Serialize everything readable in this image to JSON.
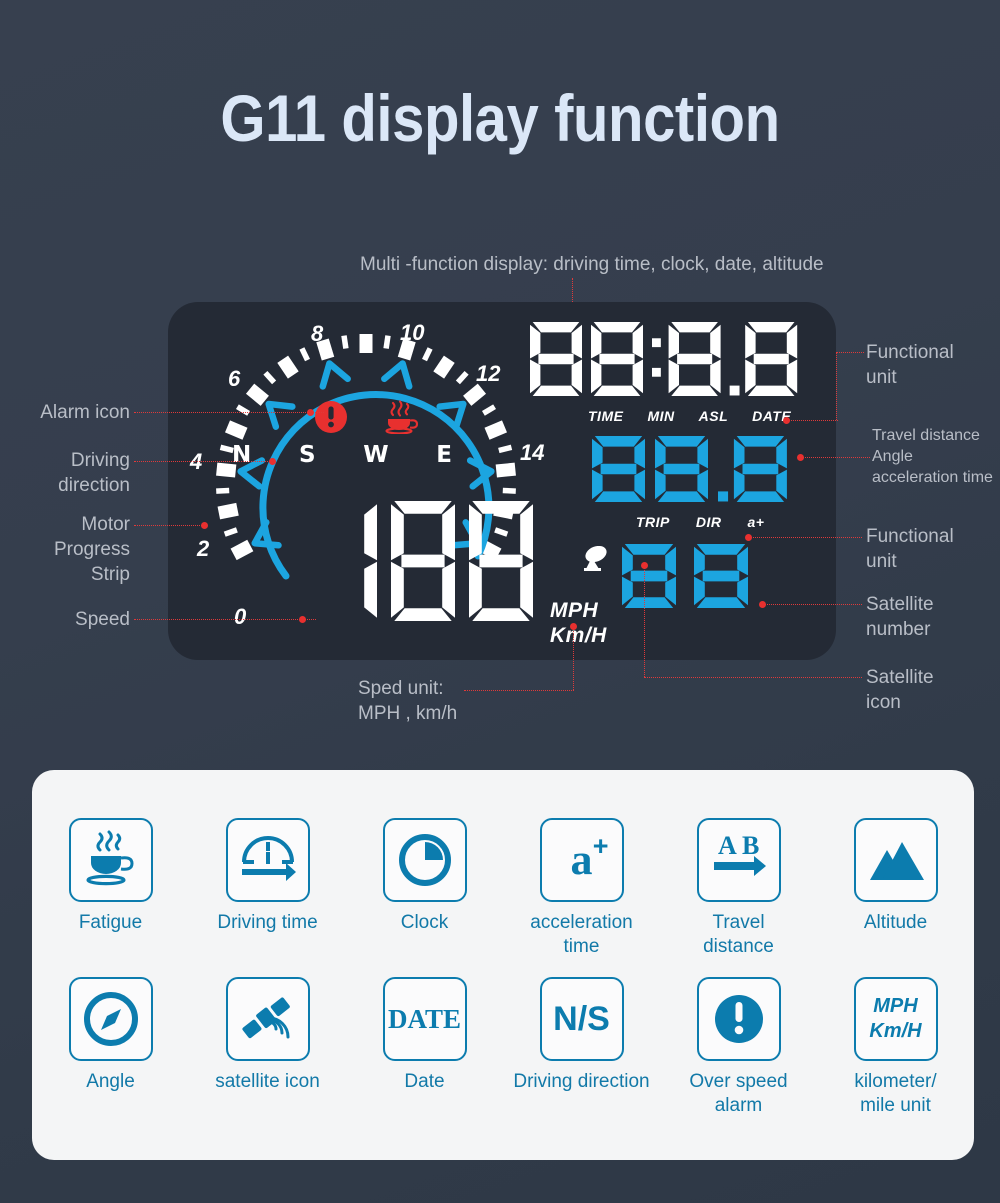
{
  "header": {
    "title": "G11 display function"
  },
  "hud": {
    "gauge": {
      "tick_labels": [
        "0",
        "2",
        "4",
        "6",
        "8",
        "10",
        "12",
        "14"
      ],
      "compass_letters": [
        "N",
        "S",
        "W",
        "E"
      ],
      "speed_value": "188",
      "speed_units": {
        "mph": "MPH",
        "kmh": "Km/H"
      },
      "alarm_icon": "alert-exclamation-icon",
      "fatigue_icon": "coffee-cup-icon"
    },
    "multi_display": {
      "value": "88:8.8",
      "labels": [
        "TIME",
        "MIN",
        "ASL",
        "DATE"
      ]
    },
    "trip_display": {
      "value": "88.8",
      "labels": [
        "TRIP",
        "DIR",
        "a+"
      ]
    },
    "satellite_display": {
      "value": "88",
      "icon": "satellite-dish-icon"
    }
  },
  "annotations": {
    "top": "Multi -function display: driving time, clock, date, altitude",
    "left": [
      "Alarm icon",
      "Driving\ndirection",
      "Motor\nProgress\nStrip",
      "Speed"
    ],
    "left_1": "Alarm icon",
    "left_2": "Driving\ndirection",
    "left_3": "Motor\nProgress\nStrip",
    "left_4": "Speed",
    "right_1": "Functional\nunit",
    "right_2": "Travel distance\nAngle\nacceleration time",
    "right_3": "Functional\nunit",
    "right_4": "Satellite\nnumber",
    "right_5": "Satellite\nicon",
    "bottom": "Sped unit:\nMPH , km/h"
  },
  "legend": {
    "items": [
      {
        "label": "Fatigue",
        "icon": "coffee-cup-icon"
      },
      {
        "label": "Driving time",
        "icon": "speedometer-arrow-icon"
      },
      {
        "label": "Clock",
        "icon": "pie-clock-icon"
      },
      {
        "label": "acceleration\ntime",
        "icon": "a-plus-icon",
        "text": "a"
      },
      {
        "label": "Travel\ndistance",
        "icon": "a-to-b-arrow-icon"
      },
      {
        "label": "Altitude",
        "icon": "mountains-icon"
      },
      {
        "label": "Angle",
        "icon": "compass-icon"
      },
      {
        "label": "satellite icon",
        "icon": "satellite-icon"
      },
      {
        "label": "Date",
        "icon": "date-text-icon",
        "text": "DATE"
      },
      {
        "label": "Driving direction",
        "icon": "ns-text-icon",
        "text": "N/S"
      },
      {
        "label": "Over speed\nalarm",
        "icon": "exclamation-circle-icon"
      },
      {
        "label": "kilometer/\nmile unit",
        "icon": "mph-kmh-text-icon",
        "text_1": "MPH",
        "text_2": "Km/H"
      }
    ]
  },
  "colors": {
    "background_top": "#37404f",
    "background_bottom": "#2e3846",
    "hud_panel": "#242a35",
    "accent_blue": "#1CA5E0",
    "legend_blue": "#0c7cae",
    "alarm_red": "#e8302f",
    "title_color": "#dbe7f7",
    "card_bg": "#f4f5f6"
  }
}
